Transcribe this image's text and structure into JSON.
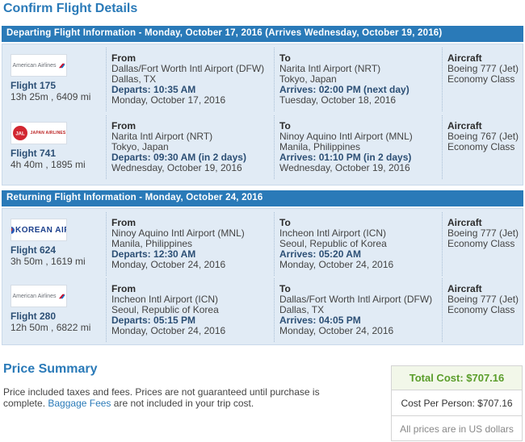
{
  "page_title": "Confirm Flight Details",
  "departing": {
    "header": "Departing Flight Information - Monday, October 17, 2016 (Arrives Wednesday, October 19, 2016)",
    "flights": [
      {
        "airline_logo": "American Airlines",
        "flight_number": "Flight 175",
        "duration_distance": "13h 25m , 6409 mi",
        "from_label": "From",
        "from_airport": "Dallas/Fort Worth Intl Airport (DFW)",
        "from_city": "Dallas, TX",
        "departs": "Departs: 10:35 AM",
        "from_date": "Monday, October 17, 2016",
        "to_label": "To",
        "to_airport": "Narita Intl Airport (NRT)",
        "to_city": "Tokyo, Japan",
        "arrives": "Arrives: 02:00 PM (next day)",
        "to_date": "Tuesday, October 18, 2016",
        "aircraft_label": "Aircraft",
        "aircraft": "Boeing 777 (Jet)",
        "cabin": "Economy Class"
      },
      {
        "airline_logo": "JAPAN AIRLINES",
        "flight_number": "Flight 741",
        "duration_distance": "4h 40m , 1895 mi",
        "from_label": "From",
        "from_airport": "Narita Intl Airport (NRT)",
        "from_city": "Tokyo, Japan",
        "departs": "Departs: 09:30 AM (in 2 days)",
        "from_date": "Wednesday, October 19, 2016",
        "to_label": "To",
        "to_airport": "Ninoy Aquino Intl Airport (MNL)",
        "to_city": "Manila, Philippines",
        "arrives": "Arrives: 01:10 PM (in 2 days)",
        "to_date": "Wednesday, October 19, 2016",
        "aircraft_label": "Aircraft",
        "aircraft": "Boeing 767 (Jet)",
        "cabin": "Economy Class"
      }
    ]
  },
  "returning": {
    "header": "Returning Flight Information - Monday, October 24, 2016",
    "flights": [
      {
        "airline_logo": "KOREAN AIR",
        "flight_number": "Flight 624",
        "duration_distance": "3h 50m , 1619 mi",
        "from_label": "From",
        "from_airport": "Ninoy Aquino Intl Airport (MNL)",
        "from_city": "Manila, Philippines",
        "departs": "Departs: 12:30 AM",
        "from_date": "Monday, October 24, 2016",
        "to_label": "To",
        "to_airport": "Incheon Intl Airport (ICN)",
        "to_city": "Seoul, Republic of Korea",
        "arrives": "Arrives: 05:20 AM",
        "to_date": "Monday, October 24, 2016",
        "aircraft_label": "Aircraft",
        "aircraft": "Boeing 777 (Jet)",
        "cabin": "Economy Class"
      },
      {
        "airline_logo": "American Airlines",
        "flight_number": "Flight 280",
        "duration_distance": "12h 50m , 6822 mi",
        "from_label": "From",
        "from_airport": "Incheon Intl Airport (ICN)",
        "from_city": "Seoul, Republic of Korea",
        "departs": "Departs: 05:15 PM",
        "from_date": "Monday, October 24, 2016",
        "to_label": "To",
        "to_airport": "Dallas/Fort Worth Intl Airport (DFW)",
        "to_city": "Dallas, TX",
        "arrives": "Arrives: 04:05 PM",
        "to_date": "Monday, October 24, 2016",
        "aircraft_label": "Aircraft",
        "aircraft": "Boeing 777 (Jet)",
        "cabin": "Economy Class"
      }
    ]
  },
  "price_summary": {
    "title": "Price Summary",
    "note_before": "Price included taxes and fees. Prices are not guaranteed until purchase is complete.",
    "note_link": "Baggage Fees",
    "note_after": "are not included in your trip cost.",
    "total_cost": "Total Cost: $707.16",
    "cost_per_person": "Cost Per Person: $707.16",
    "currency_note": "All prices are in US dollars"
  },
  "colors": {
    "accent": "#2a7ab8",
    "section_bg": "#e1ebf5",
    "total_green": "#5a9d2a"
  },
  "icons": {
    "american_airlines": "american-airlines-logo",
    "japan_airlines": "jal-crane-logo",
    "korean_air": "korean-air-taeguk-logo"
  }
}
